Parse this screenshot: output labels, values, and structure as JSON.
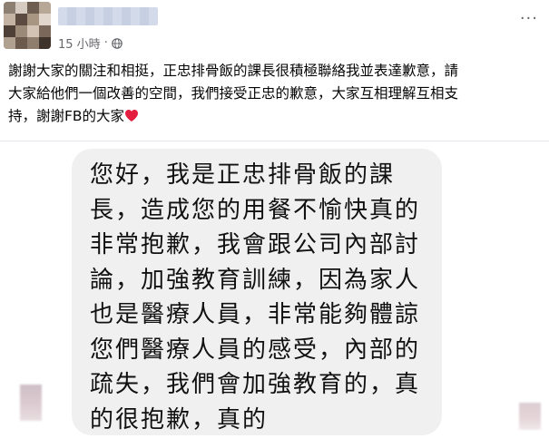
{
  "post": {
    "time_label": "15 小時",
    "separator": "·",
    "privacy_icon": "globe-icon",
    "more_label": "···",
    "text": "謝謝大家的關注和相挺，正忠排骨飯的課長很積極聯絡我並表達歉意，請\n大家給他們一個改善的空間，我們接受正忠的歉意，大家互相理解互相支\n持，謝謝FB的大家",
    "heart_emoji": "heart-icon"
  },
  "screenshot": {
    "message": "您好，我是正忠排骨飯的課長，造成您的用餐不愉快真的非常抱歉，我會跟公司內部討論，加強教育訓練，因為家人也是醫療人員，非常能夠體諒您們醫療人員的感受，內部的疏失，我們會加強教育的，真的很抱歉，真的"
  },
  "colors": {
    "text": "#050505",
    "meta": "#65676b",
    "bubble": "#f0f0f0",
    "heart": "#e41e3f"
  }
}
